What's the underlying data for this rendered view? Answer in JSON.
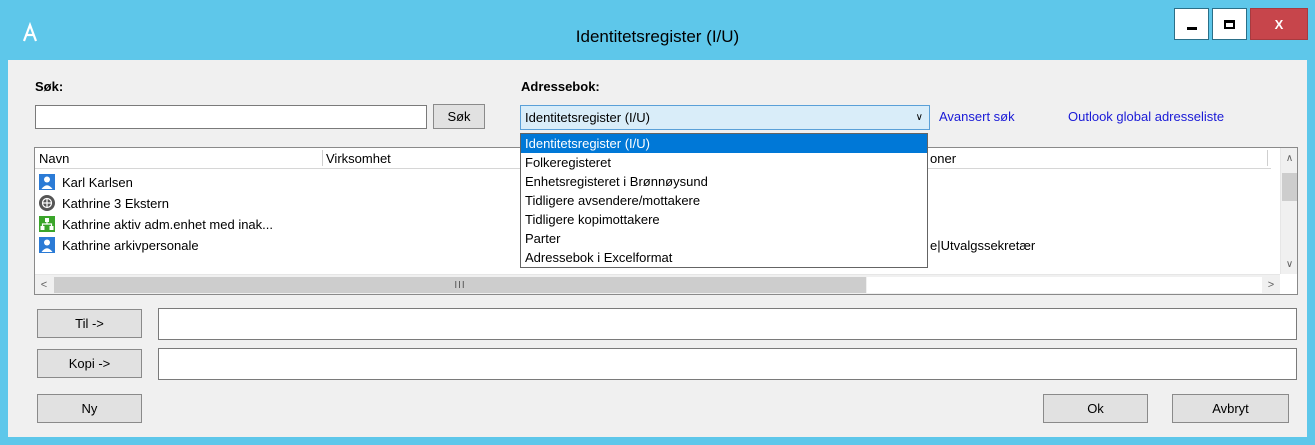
{
  "window": {
    "title": "Identitetsregister (I/U)",
    "close_label": "X"
  },
  "search": {
    "label": "Søk:",
    "value": "",
    "button_label": "Søk"
  },
  "addressbook": {
    "label": "Adressebok:",
    "selected": "Identitetsregister (I/U)",
    "options": [
      "Identitetsregister (I/U)",
      "Folkeregisteret",
      "Enhetsregisteret i Brønnøysund",
      "Tidligere avsendere/mottakere",
      "Tidligere kopimottakere",
      "Parter",
      "Adressebok i Excelformat"
    ]
  },
  "links": {
    "advanced_search": "Avansert søk",
    "outlook_global": "Outlook global adresseliste"
  },
  "list": {
    "columns": [
      "Navn",
      "Virksomhet",
      "oner"
    ],
    "rows": [
      {
        "name": "Karl Karlsen",
        "icon": "person-icon",
        "roles": ""
      },
      {
        "name": "Kathrine 3 Ekstern",
        "icon": "external-globe-icon",
        "roles": ""
      },
      {
        "name": "Kathrine aktiv adm.enhet med inak...",
        "icon": "org-unit-icon",
        "roles": ""
      },
      {
        "name": "Kathrine arkivpersonale",
        "icon": "person-icon",
        "roles": "e|Utvalgssekretær"
      }
    ],
    "hscroll_grip": "III"
  },
  "recipients": {
    "to_label": "Til ->",
    "to_value": "",
    "copy_label": "Kopi ->",
    "copy_value": ""
  },
  "buttons": {
    "new": "Ny",
    "ok": "Ok",
    "cancel": "Avbryt"
  },
  "colors": {
    "titlebar": "#5ec7ea",
    "close": "#c7454b",
    "selection": "#0078d7",
    "link": "#1a1ad7",
    "person_icon": "#2b7bd6",
    "org_icon": "#3aa52a",
    "external_icon": "#555555"
  }
}
